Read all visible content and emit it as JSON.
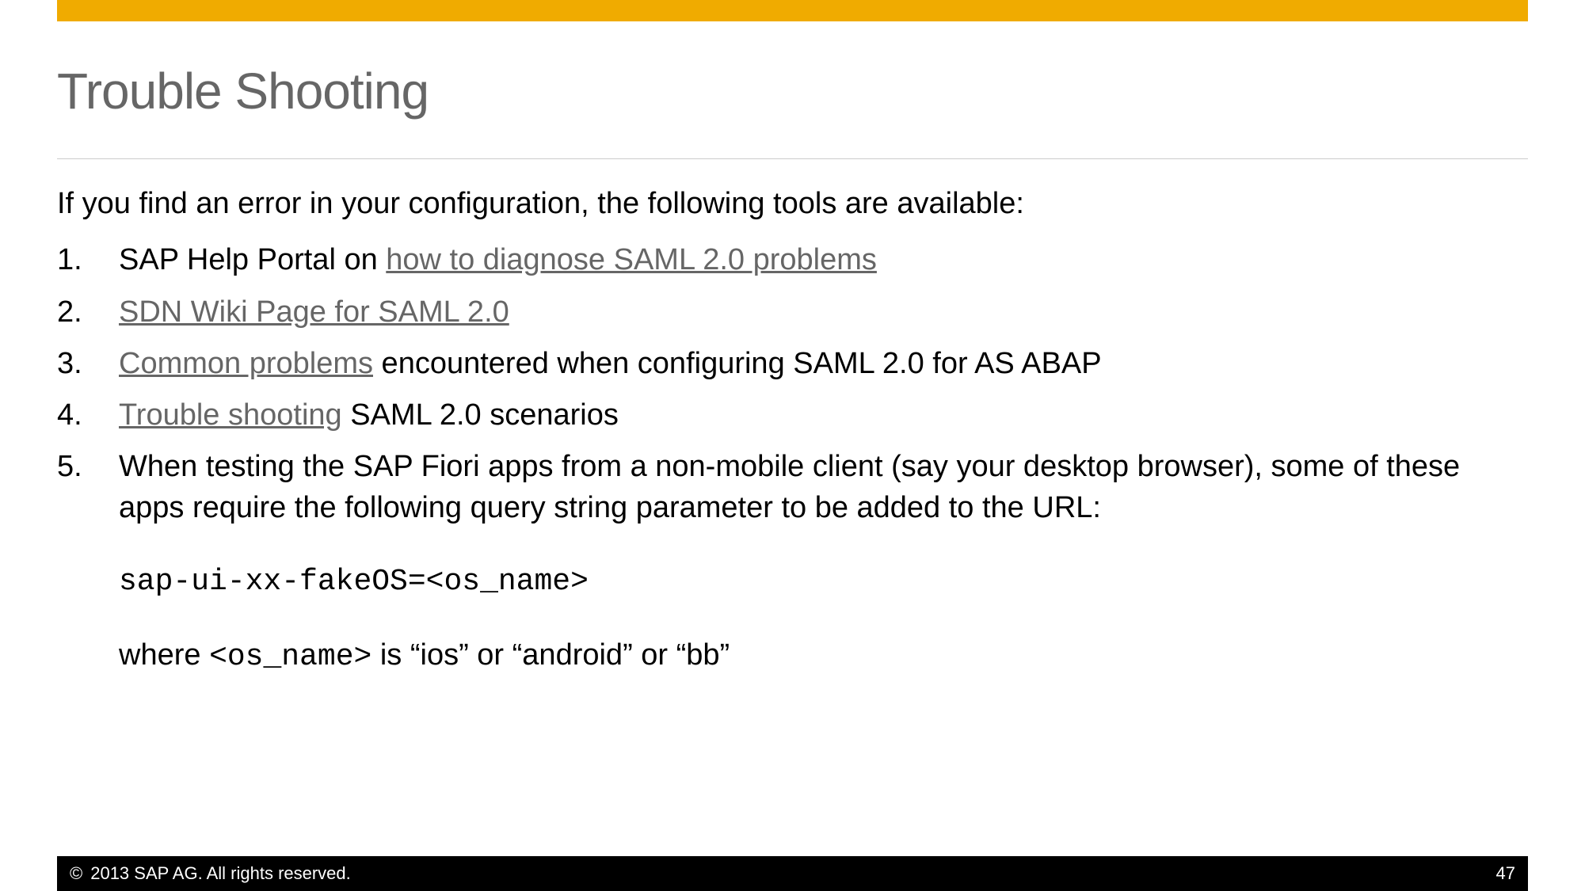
{
  "title": "Trouble Shooting",
  "intro": "If you find an error in your configuration, the following tools are available:",
  "items": {
    "item1": {
      "prefix": "SAP Help Portal on ",
      "link": "how to diagnose SAML 2.0 problems"
    },
    "item2": {
      "link": "SDN Wiki Page for SAML 2.0"
    },
    "item3": {
      "link": "Common problems",
      "suffix": " encountered when configuring SAML 2.0 for AS ABAP"
    },
    "item4": {
      "link": "Trouble shooting",
      "suffix": " SAML 2.0 scenarios"
    },
    "item5": {
      "para1": "When testing the SAP Fiori apps from a non-mobile client (say your desktop browser), some of these apps require the following query string parameter to be added to the URL:",
      "code": "sap-ui-xx-fakeOS=<os_name>",
      "where_prefix": "where ",
      "where_code": "<os_name>",
      "where_suffix": " is “ios” or “android” or “bb”"
    }
  },
  "footer": {
    "copyright_symbol": "©",
    "copyright_text": "2013 SAP AG. All rights reserved.",
    "page_number": "47"
  }
}
